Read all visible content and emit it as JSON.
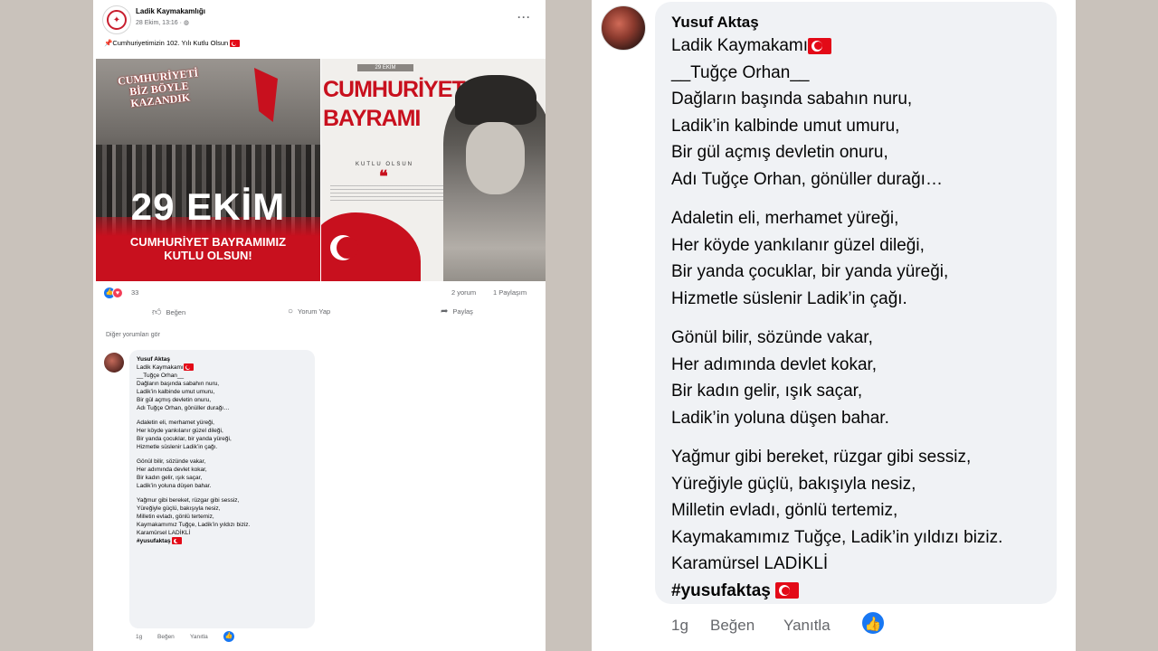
{
  "post": {
    "page_name": "Ladik Kaymakamlığı",
    "meta": "28 Ekim, 13:16 · ",
    "text": "Cumhuriyetimizin 102. Yılı Kutlu Olsun",
    "image_left": {
      "slogan": "CUMHURİYETİ BİZ BÖYLE KAZANDIK",
      "date": "29 EKİM",
      "line1": "CUMHURİYET BAYRAMIMIZ",
      "line2": "KUTLU OLSUN!"
    },
    "image_right": {
      "tag": "29 EKİM",
      "title_line1": "CUMHURİYET",
      "title_line2": "BAYRAMI",
      "subtitle": "KUTLU OLSUN"
    },
    "reaction_count": "33",
    "comments_count": "2 yorum",
    "shares_count": "1 Paylaşım",
    "like_label": "Beğen",
    "comment_label": "Yorum Yap",
    "share_label": "Paylaş",
    "more_comments": "Diğer yorumları gör"
  },
  "comment": {
    "author": "Yusuf Aktaş",
    "line_1": "Ladik Kaymakamı",
    "line_2": "__Tuğçe Orhan__",
    "stanza1": [
      "Dağların başında sabahın nuru,",
      "Ladik’in kalbinde umut umuru,",
      "Bir gül açmış devletin onuru,",
      "Adı Tuğçe Orhan, gönüller durağı…"
    ],
    "stanza2": [
      "Adaletin eli, merhamet yüreği,",
      "Her köyde yankılanır güzel dileği,",
      "Bir yanda çocuklar, bir yanda yüreği,",
      "Hizmetle süslenir Ladik’in çağı."
    ],
    "stanza3": [
      "Gönül bilir, sözünde vakar,",
      "Her adımında devlet kokar,",
      "Bir kadın gelir, ışık saçar,",
      "Ladik’in yoluna düşen bahar."
    ],
    "stanza4": [
      "Yağmur gibi bereket, rüzgar gibi sessiz,",
      "Yüreğiyle güçlü, bakışıyla nesiz,",
      "Milletin evladı, gönlü tertemiz,",
      "Kaymakamımız Tuğçe, Ladik’in yıldızı biziz."
    ],
    "signature": "Karamürsel LADİKLİ",
    "hashtag": "#yusufaktaş",
    "time": "1g",
    "like": "Beğen",
    "reply": "Yanıtla"
  },
  "icons": {
    "like": "like-icon",
    "love": "love-icon",
    "comment": "comment-icon",
    "share": "share-icon",
    "more": "more-options-icon",
    "flag": "turkish-flag-icon"
  },
  "colors": {
    "accent_blue": "#1877f2",
    "flag_red": "#e30a17",
    "bubble_bg": "#f0f2f5",
    "muted_text": "#65676b"
  }
}
